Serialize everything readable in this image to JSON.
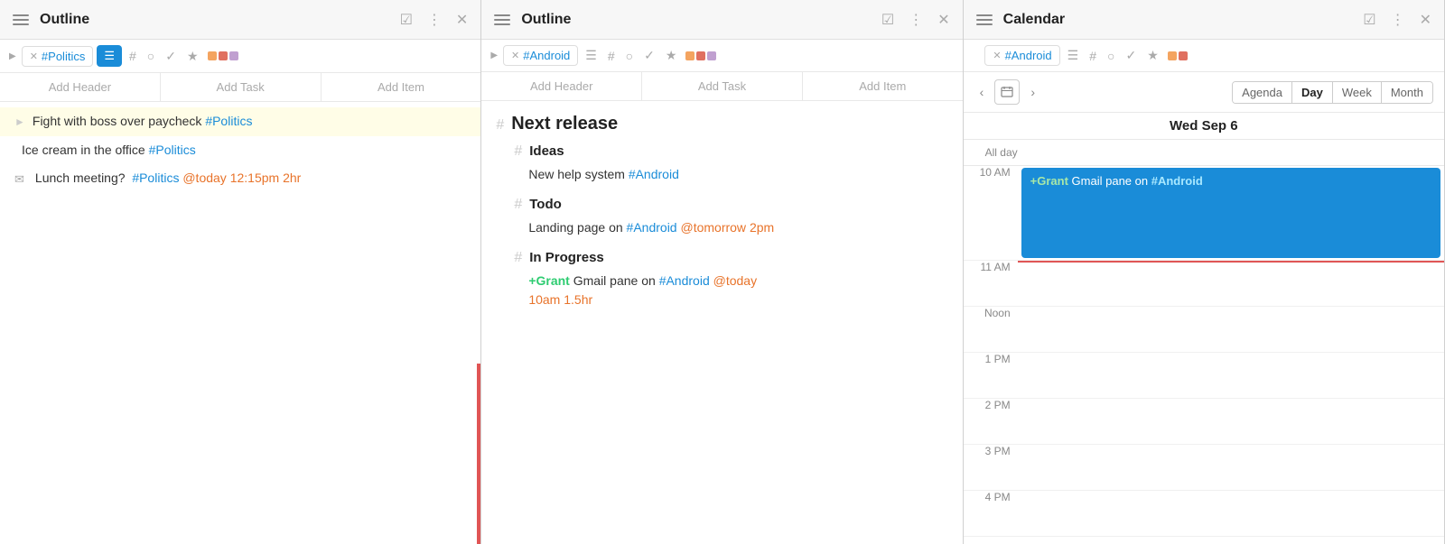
{
  "panels": [
    {
      "id": "panel1",
      "title": "Outline",
      "filter_tag": "#Politics",
      "toolbar": [
        "Add Header",
        "Add Task",
        "Add Item"
      ],
      "items": [
        {
          "type": "highlighted",
          "text_parts": [
            {
              "text": "Fight with boss over paycheck ",
              "type": "plain"
            },
            {
              "text": "#Politics",
              "type": "tag"
            }
          ]
        },
        {
          "type": "normal",
          "text_parts": [
            {
              "text": "Ice cream in the office ",
              "type": "plain"
            },
            {
              "text": "#Politics",
              "type": "tag"
            }
          ]
        },
        {
          "type": "normal",
          "has_mail_icon": true,
          "text_parts": [
            {
              "text": "Lunch meeting?  ",
              "type": "plain"
            },
            {
              "text": "#Politics",
              "type": "tag"
            },
            {
              "text": " @today",
              "type": "date"
            },
            {
              "text": " 12:15pm 2hr",
              "type": "time"
            }
          ]
        }
      ]
    },
    {
      "id": "panel2",
      "title": "Outline",
      "filter_tag": "#Android",
      "toolbar": [
        "Add Header",
        "Add Task",
        "Add Item"
      ],
      "sections": [
        {
          "header": "Next release",
          "level": "h1",
          "subsections": [
            {
              "header": "Ideas",
              "level": "h2",
              "items": [
                {
                  "text_parts": [
                    {
                      "text": "New help system ",
                      "type": "plain"
                    },
                    {
                      "text": "#Android",
                      "type": "tag"
                    }
                  ]
                }
              ]
            },
            {
              "header": "Todo",
              "level": "h2",
              "items": [
                {
                  "text_parts": [
                    {
                      "text": "Landing page on ",
                      "type": "plain"
                    },
                    {
                      "text": "#Android",
                      "type": "tag"
                    },
                    {
                      "text": " @tomorrow",
                      "type": "date"
                    },
                    {
                      "text": " 2pm",
                      "type": "time"
                    }
                  ]
                }
              ]
            },
            {
              "header": "In Progress",
              "level": "h2",
              "items": [
                {
                  "text_parts": [
                    {
                      "text": "+Grant",
                      "type": "person"
                    },
                    {
                      "text": " Gmail pane on ",
                      "type": "plain"
                    },
                    {
                      "text": "#Android",
                      "type": "tag"
                    },
                    {
                      "text": " @today",
                      "type": "date"
                    },
                    {
                      "text": "\n10am 1.5hr",
                      "type": "time"
                    }
                  ]
                }
              ]
            }
          ]
        }
      ]
    },
    {
      "id": "panel3",
      "title": "Calendar",
      "filter_tag": "#Android",
      "view_buttons": [
        "Agenda",
        "Day",
        "Week",
        "Month"
      ],
      "active_view": "Day",
      "date_heading": "Wed Sep 6",
      "time_slots": [
        {
          "label": "All day",
          "type": "allday"
        },
        {
          "label": "10 AM",
          "type": "time"
        },
        {
          "label": "11 AM",
          "type": "time",
          "has_event": true,
          "has_current_time": true,
          "event": {
            "text_parts": [
              {
                "text": "+Grant",
                "type": "person"
              },
              {
                "text": " Gmail pane on ",
                "type": "plain"
              },
              {
                "text": "#Android",
                "type": "tag"
              }
            ]
          }
        },
        {
          "label": "Noon",
          "type": "time"
        },
        {
          "label": "1 PM",
          "type": "time"
        },
        {
          "label": "2 PM",
          "type": "time"
        },
        {
          "label": "3 PM",
          "type": "time"
        },
        {
          "label": "4 PM",
          "type": "time"
        }
      ]
    }
  ],
  "icons": {
    "hamburger": "☰",
    "checkmark": "✓",
    "dots": "⋮",
    "close": "✕",
    "arrow_left": "‹",
    "arrow_right": "›",
    "calendar_icon": "📅",
    "mail_icon": "✉",
    "hash": "#",
    "list_icon": "≡",
    "circle": "○",
    "star": "★",
    "expand": "▶"
  },
  "colors": {
    "tag_blue": "#1a8cd8",
    "date_orange": "#e8732a",
    "person_green": "#2ecc71",
    "accent_red": "#e05555",
    "highlight_yellow": "#fffde7",
    "color_dot1": "#f4a460",
    "color_dot2": "#e07060",
    "color_dot3": "#c0a0d0"
  }
}
